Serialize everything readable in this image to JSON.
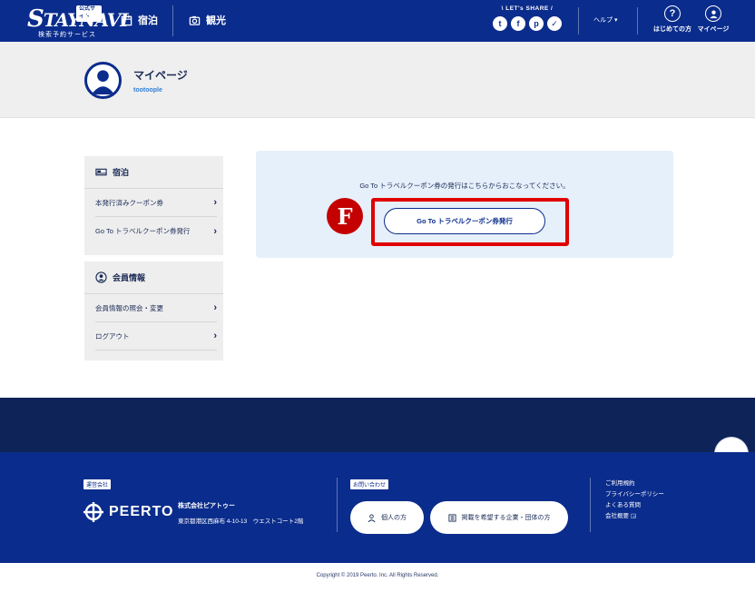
{
  "header": {
    "logo_badge": "公式サイト",
    "logo_s": "S",
    "logo_rest": "TAYNAVI",
    "logo_sub": "検索予約サービス",
    "nav": [
      {
        "label": "宿泊",
        "icon": "calendar-icon"
      },
      {
        "label": "観光",
        "icon": "camera-icon"
      }
    ],
    "share_title": "\\ LET's SHARE /",
    "share_icons": [
      "twitter-icon",
      "facebook-icon",
      "pinterest-icon",
      "pocket-icon"
    ],
    "help_label": "ヘルプ ▾",
    "first_time_label": "はじめての方",
    "mypage_label": "マイページ"
  },
  "profile": {
    "title": "マイページ",
    "username": "tootoople"
  },
  "sidebar": {
    "sections": [
      {
        "title": "宿泊",
        "icon": "bed-icon",
        "items": [
          "本発行済みクーポン券",
          "Go To トラベルクーポン券発行"
        ]
      },
      {
        "title": "会員情報",
        "icon": "member-icon",
        "items": [
          "会員情報の照会・変更",
          "ログアウト"
        ]
      }
    ]
  },
  "main": {
    "instruction": "Go To トラベルクーポン券の発行はこちらからおこなってください。",
    "issue_button": "Go To トラベルクーポン券発行",
    "marker_label": "F"
  },
  "footer": {
    "operator_tag": "運営会社",
    "company_logo": "PEERTO",
    "company_name": "株式会社ピアトゥー",
    "company_address": "東京都港区西麻布 4-10-13　ウエストコート2階",
    "contact_tag": "お問い合わせ",
    "contact_individual": "個人の方",
    "contact_business": "掲載を希望する企業・団体の方",
    "links": [
      "ご利用規約",
      "プライバシーポリシー",
      "よくある質問",
      "会社概要"
    ],
    "copyright": "Copyright © 2019 Peerto. Inc. All Rights Reserved."
  },
  "colors": {
    "brand_navy": "#0a2c8c",
    "footer_dark": "#0e2358",
    "panel_bg": "#e6f0fb",
    "highlight_red": "#e00000"
  }
}
